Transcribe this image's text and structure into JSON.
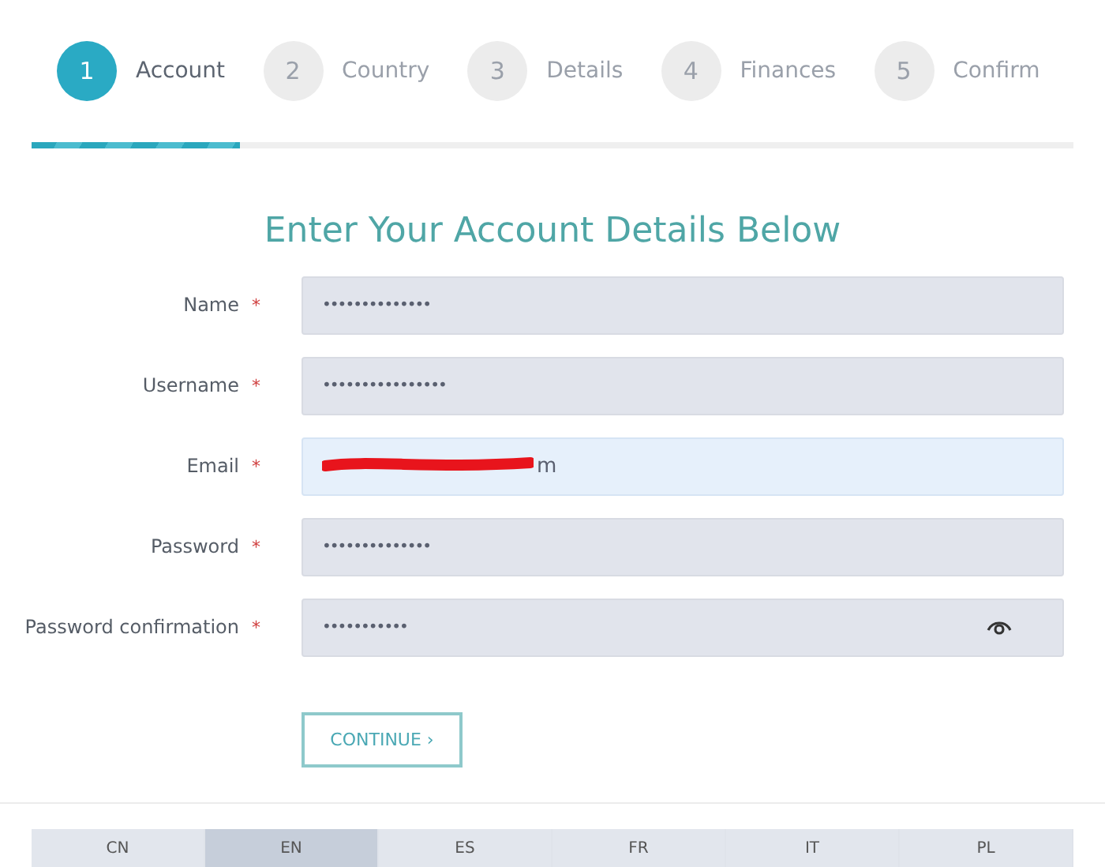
{
  "steps": [
    {
      "number": "1",
      "label": "Account",
      "selected": true
    },
    {
      "number": "2",
      "label": "Country",
      "selected": false
    },
    {
      "number": "3",
      "label": "Details",
      "selected": false
    },
    {
      "number": "4",
      "label": "Finances",
      "selected": false
    },
    {
      "number": "5",
      "label": "Confirm",
      "selected": false
    }
  ],
  "progress": {
    "level": 0.2
  },
  "title": "Enter Your Account Details Below",
  "fields": [
    {
      "label": "Name",
      "required_mark": "*",
      "kind": "text",
      "value": "••••••••••••••",
      "focused": false
    },
    {
      "label": "Username",
      "required_mark": "*",
      "kind": "text",
      "value": "••••••••••••••••",
      "focused": false
    },
    {
      "label": "Email",
      "required_mark": "*",
      "kind": "text",
      "value": "m",
      "focused": true,
      "redacted": true
    },
    {
      "label": "Password",
      "required_mark": "*",
      "kind": "text",
      "value": "••••••••••••••",
      "focused": false
    },
    {
      "label": "Password confirmation",
      "required_mark": "*",
      "kind": "password",
      "value": "•••••••••••",
      "focused": false
    }
  ],
  "continue_button": "CONTINUE ›",
  "languages": [
    {
      "label": "CN",
      "selected": false
    },
    {
      "label": "EN",
      "selected": true
    },
    {
      "label": "ES",
      "selected": false
    },
    {
      "label": "FR",
      "selected": false
    },
    {
      "label": "IT",
      "selected": false
    },
    {
      "label": "PL",
      "selected": false
    }
  ]
}
